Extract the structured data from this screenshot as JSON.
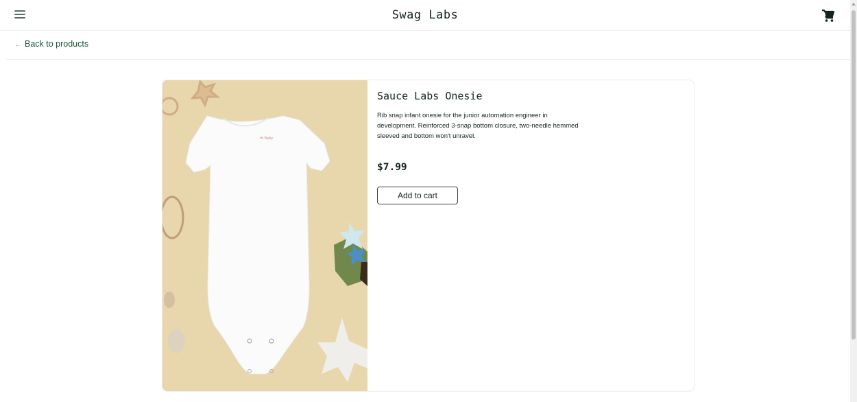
{
  "header": {
    "menu_icon": "hamburger-menu-icon",
    "title": "Swag Labs",
    "cart_icon": "shopping-cart-icon"
  },
  "subheader": {
    "back_label": "Back to products",
    "back_icon": "arrow-left-icon"
  },
  "product": {
    "name": "Sauce Labs Onesie",
    "description": "Rib snap infant onesie for the junior automation engineer in development. Reinforced 3-snap bottom closure, two-needle hemmed sleeved and bottom won't unravel.",
    "price": "$7.99",
    "add_to_cart_label": "Add to cart",
    "image_alt": "Sauce Labs Onesie"
  },
  "colors": {
    "accent": "#18583a",
    "text": "#132322",
    "image_background": "#e8d6ac"
  }
}
